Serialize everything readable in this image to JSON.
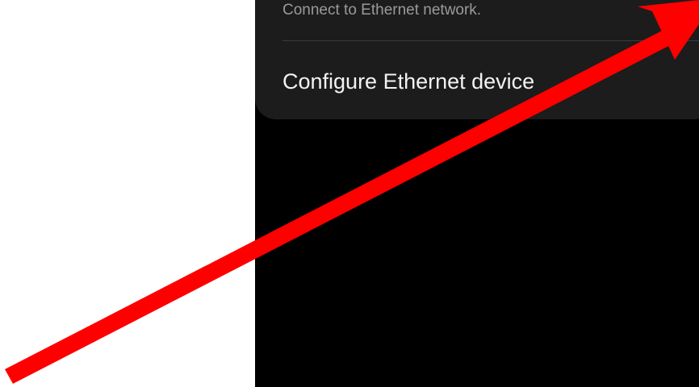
{
  "settings": {
    "ethernet_item": {
      "subtitle": "Connect to Ethernet network."
    },
    "configure_item": {
      "title": "Configure Ethernet device"
    }
  },
  "colors": {
    "screen_background": "#000000",
    "card_background": "#1c1c1c",
    "subtitle_text": "#9a9a9a",
    "title_text": "#f2f2f2",
    "annotation_arrow": "#ff0000"
  },
  "annotation": {
    "icon": "red-arrow-pointer"
  }
}
